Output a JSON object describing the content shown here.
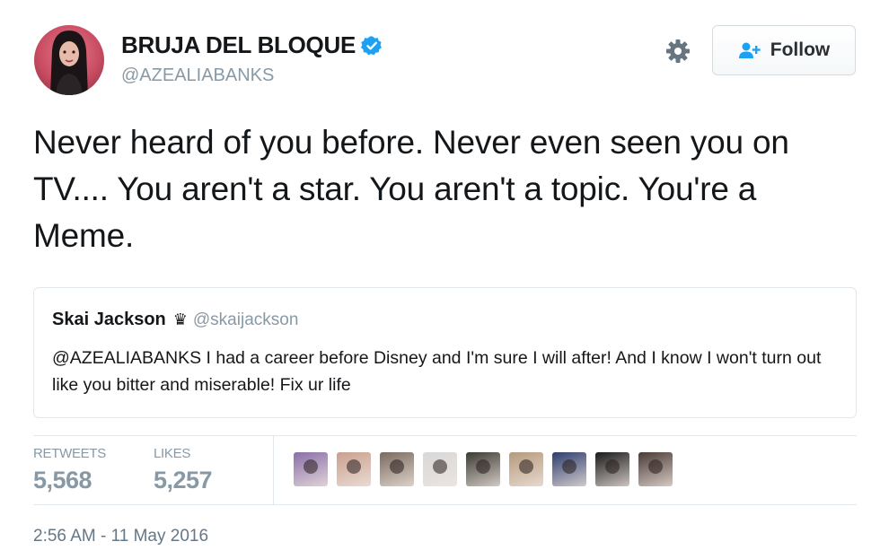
{
  "user": {
    "display_name": "BRUJA DEL BLOQUE",
    "handle": "@AZEALIABANKS",
    "verified": true
  },
  "actions": {
    "follow_label": "Follow"
  },
  "tweet": {
    "text": "Never heard of you before. Never even seen you on TV.... You aren't a star. You aren't a topic. You're a Meme."
  },
  "quoted_tweet": {
    "name": "Skai Jackson",
    "handle": "@skaijackson",
    "text": "@AZEALIABANKS I had a career before Disney and I'm sure I will after! And I know I won't turn out like you bitter and miserable! Fix ur life"
  },
  "stats": {
    "retweets_label": "RETWEETS",
    "retweets_value": "5,568",
    "likes_label": "LIKES",
    "likes_value": "5,257"
  },
  "likers": [
    {
      "color": "#8a6fa8"
    },
    {
      "color": "#c9a08e"
    },
    {
      "color": "#7a6a5e"
    },
    {
      "color": "#d8d8d8"
    },
    {
      "color": "#3c3a34"
    },
    {
      "color": "#b59a7c"
    },
    {
      "color": "#2e3e6e"
    },
    {
      "color": "#1a1a1a"
    },
    {
      "color": "#4a3a36"
    }
  ],
  "timestamp": "2:56 AM - 11 May 2016",
  "colors": {
    "accent": "#1da1f2",
    "muted": "#8899a6",
    "border": "#e1e8ed",
    "text": "#14171a"
  }
}
